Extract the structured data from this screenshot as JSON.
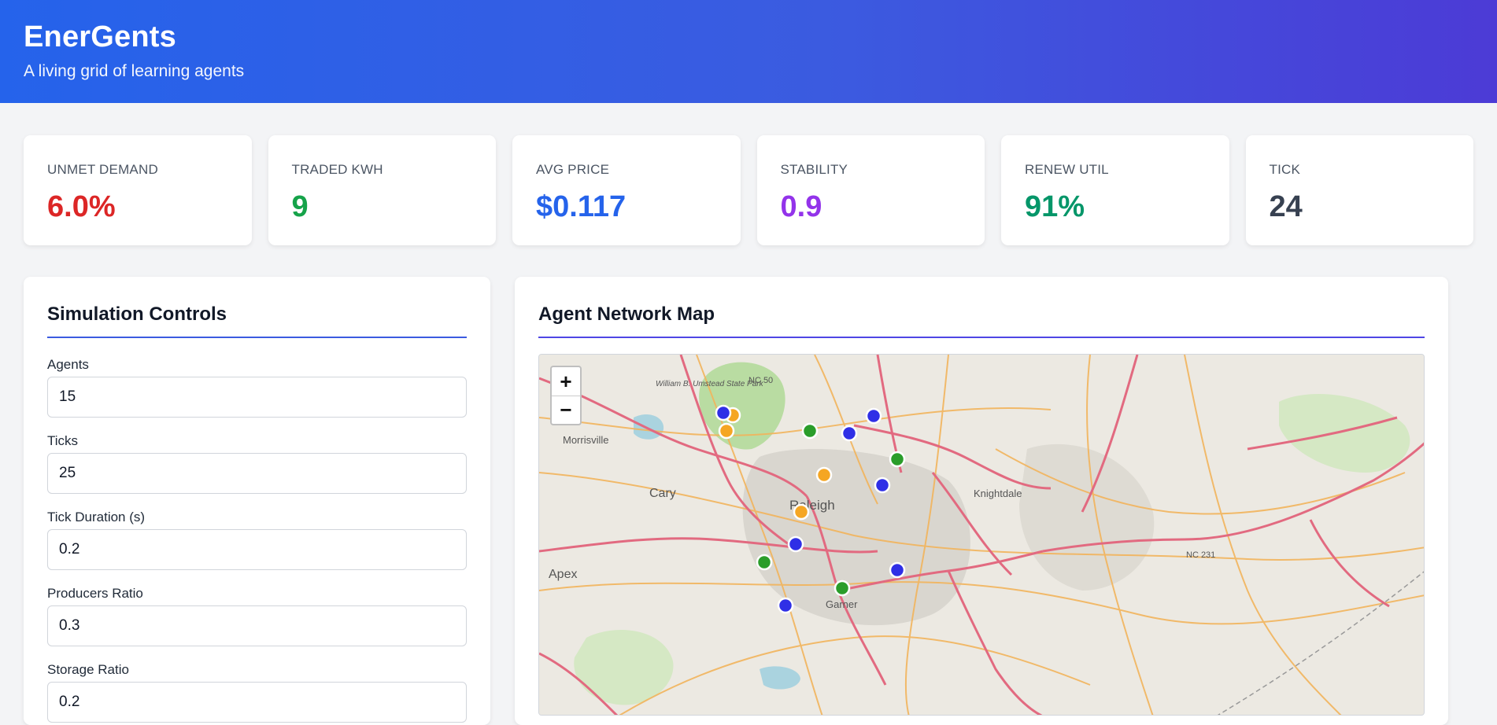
{
  "header": {
    "title": "EnerGents",
    "subtitle": "A living grid of learning agents"
  },
  "stats": [
    {
      "label": "Unmet Demand",
      "value": "6.0%",
      "color": "#dc2626"
    },
    {
      "label": "Traded kWh",
      "value": "9",
      "color": "#16a34a"
    },
    {
      "label": "Avg Price",
      "value": "$0.117",
      "color": "#2563eb"
    },
    {
      "label": "Stability",
      "value": "0.9",
      "color": "#9333ea"
    },
    {
      "label": "Renew Util",
      "value": "91%",
      "color": "#059669"
    },
    {
      "label": "Tick",
      "value": "24",
      "color": "#374151"
    }
  ],
  "controls": {
    "title": "Simulation Controls",
    "fields": [
      {
        "label": "Agents",
        "value": "15"
      },
      {
        "label": "Ticks",
        "value": "25"
      },
      {
        "label": "Tick Duration (s)",
        "value": "0.2"
      },
      {
        "label": "Producers Ratio",
        "value": "0.3"
      },
      {
        "label": "Storage Ratio",
        "value": "0.2"
      }
    ]
  },
  "map": {
    "title": "Agent Network Map",
    "zoom_in": "+",
    "zoom_out": "−",
    "places": [
      "Morrisville",
      "Cary",
      "Raleigh",
      "Apex",
      "Garner",
      "Knightdale",
      "William B. Umstead State Park",
      "NC 50",
      "NC 231"
    ],
    "agent_colors": {
      "producer": "#2a9d2a",
      "consumer": "#2f2fe6",
      "storage": "#f5a623"
    }
  }
}
